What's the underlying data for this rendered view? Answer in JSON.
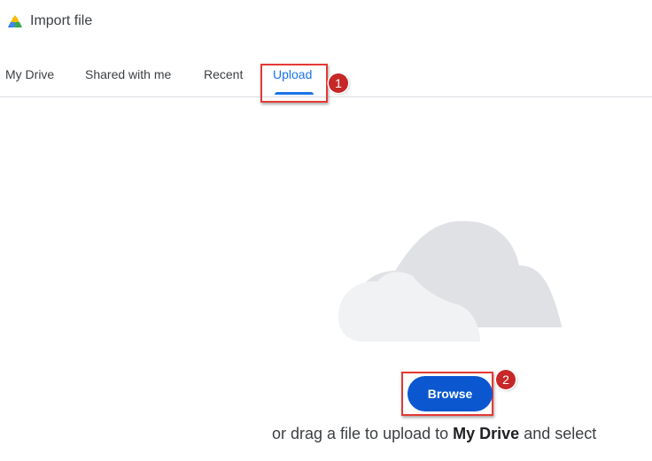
{
  "header": {
    "title": "Import file",
    "logo_icon": "google-drive-logo-icon"
  },
  "tabs": [
    {
      "label": "My Drive",
      "active": false
    },
    {
      "label": "Shared with me",
      "active": false
    },
    {
      "label": "Recent",
      "active": false
    },
    {
      "label": "Upload",
      "active": true
    }
  ],
  "annotations": {
    "marker_1": "1",
    "marker_2": "2"
  },
  "upload": {
    "illustration_icon": "cloud-icon",
    "browse_label": "Browse",
    "drag_prefix": "or drag a file to upload to ",
    "drag_target": "My Drive",
    "drag_suffix": " and select"
  },
  "colors": {
    "accent": "#1a73e8",
    "button": "#0b57d0",
    "highlight": "#e53935",
    "marker": "#c62828"
  }
}
